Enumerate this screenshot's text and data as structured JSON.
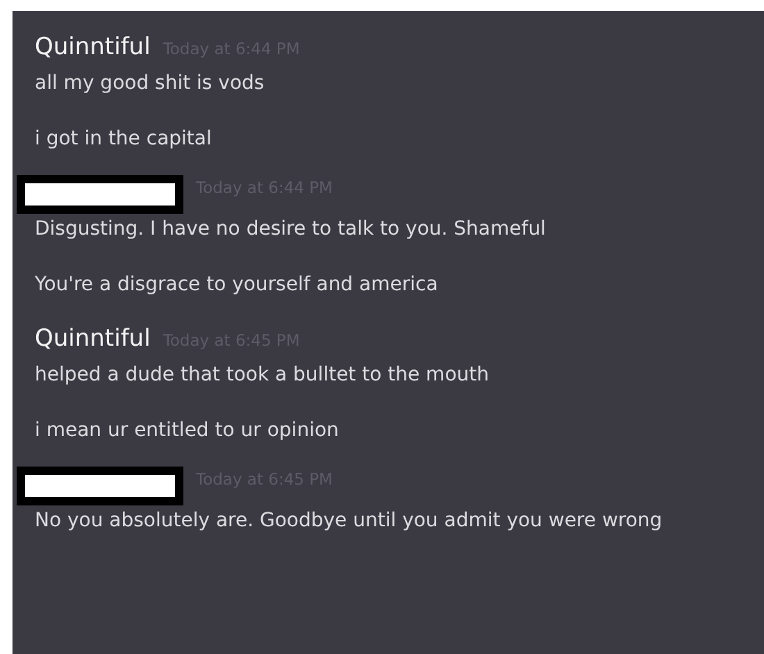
{
  "messages": [
    {
      "kind": "named",
      "author": "Quinntiful",
      "time": "Today at 6:44 PM",
      "lines": [
        "all my good shit is vods",
        "i got in the capital"
      ]
    },
    {
      "kind": "redacted",
      "time": "Today at 6:44 PM",
      "lines": [
        "Disgusting. I have no desire to talk to you. Shameful",
        "You're a disgrace to yourself and america"
      ]
    },
    {
      "kind": "named",
      "author": "Quinntiful",
      "time": "Today at 6:45 PM",
      "lines": [
        "helped a dude that took a bulltet to the mouth",
        "i mean ur entitled to ur opinion"
      ]
    },
    {
      "kind": "redacted",
      "time": "Today at 6:45 PM",
      "lines": [
        "No you absolutely are. Goodbye until you admit you were wrong"
      ]
    }
  ]
}
